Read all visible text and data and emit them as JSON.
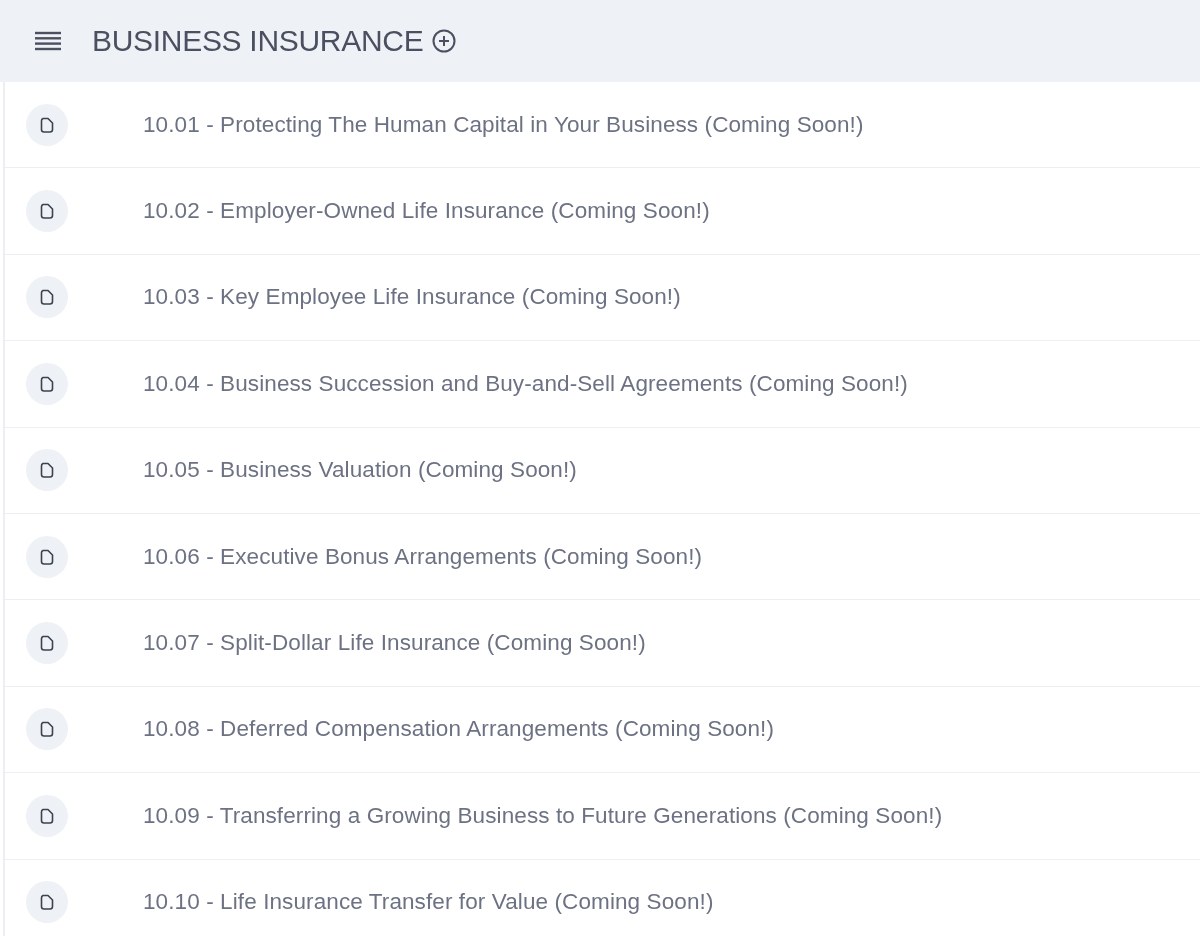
{
  "header": {
    "title": "BUSINESS INSURANCE"
  },
  "lessons": [
    {
      "title": "10.01 - Protecting The Human Capital in Your Business (Coming Soon!)"
    },
    {
      "title": "10.02 - Employer-Owned Life Insurance (Coming Soon!)"
    },
    {
      "title": "10.03 - Key Employee Life Insurance (Coming Soon!)"
    },
    {
      "title": "10.04 - Business Succession and Buy-and-Sell Agreements (Coming Soon!)"
    },
    {
      "title": "10.05 - Business Valuation (Coming Soon!)"
    },
    {
      "title": "10.06 - Executive Bonus Arrangements (Coming Soon!)"
    },
    {
      "title": "10.07 - Split-Dollar Life Insurance (Coming Soon!)"
    },
    {
      "title": "10.08 - Deferred Compensation Arrangements (Coming Soon!)"
    },
    {
      "title": "10.09 - Transferring a Growing Business to Future Generations (Coming Soon!)"
    },
    {
      "title": "10.10 - Life Insurance Transfer for Value (Coming Soon!)"
    }
  ]
}
